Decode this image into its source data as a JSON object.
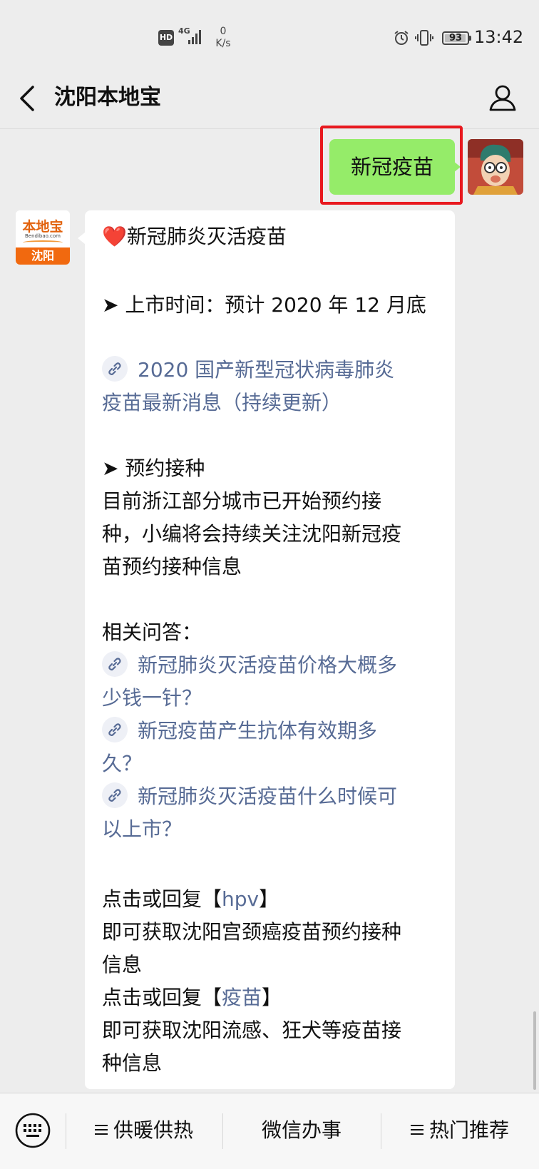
{
  "status_bar": {
    "hd": "HD",
    "network": "4G",
    "speed_value": "0",
    "speed_unit": "K/s",
    "battery": "93",
    "time": "13:42"
  },
  "nav": {
    "title": "沈阳本地宝",
    "back_icon": "chevron-left-icon",
    "profile_icon": "person-icon"
  },
  "sent_message": {
    "text": "新冠疫苗",
    "bubble_color": "#95ec69",
    "highlight_color": "#e8191f"
  },
  "bot": {
    "avatar_logo": "本地宝",
    "avatar_sub": "Bendibao.com",
    "avatar_city": "沈阳",
    "avatar_color": "#f1690f"
  },
  "reply": {
    "heading_icon": "❤️",
    "heading": "新冠肺炎灭活疫苗",
    "launch_line": "➤ 上市时间：预计 2020 年 12 月底",
    "news_link": [
      "2020 国产新型冠状病毒肺炎",
      "疫苗最新消息（持续更新）"
    ],
    "booking_heading": "➤ 预约接种",
    "booking_text": [
      "目前浙江部分城市已开始预约接",
      "种，小编将会持续关注沈阳新冠疫",
      "苗预约接种信息"
    ],
    "faq_heading": "相关问答：",
    "faq_links": [
      [
        "新冠肺炎灭活疫苗价格大概多",
        "少钱一针？"
      ],
      [
        "新冠疫苗产生抗体有效期多",
        "久？"
      ],
      [
        "新冠肺炎灭活疫苗什么时候可",
        "以上市？"
      ]
    ],
    "hpv_prefix": "点击或回复【",
    "hpv_keyword": "hpv",
    "hpv_suffix": "】",
    "hpv_text": [
      "即可获取沈阳宫颈癌疫苗预约接种",
      "信息"
    ],
    "vaccine_prefix": "点击或回复【",
    "vaccine_keyword": "疫苗",
    "vaccine_suffix": "】",
    "vaccine_text": [
      "即可获取沈阳流感、狂犬等疫苗接",
      "种信息"
    ],
    "link_color": "#576b95"
  },
  "menu": {
    "keyboard_icon": "keyboard-icon",
    "items": [
      "供暖供热",
      "微信办事",
      "热门推荐"
    ]
  }
}
